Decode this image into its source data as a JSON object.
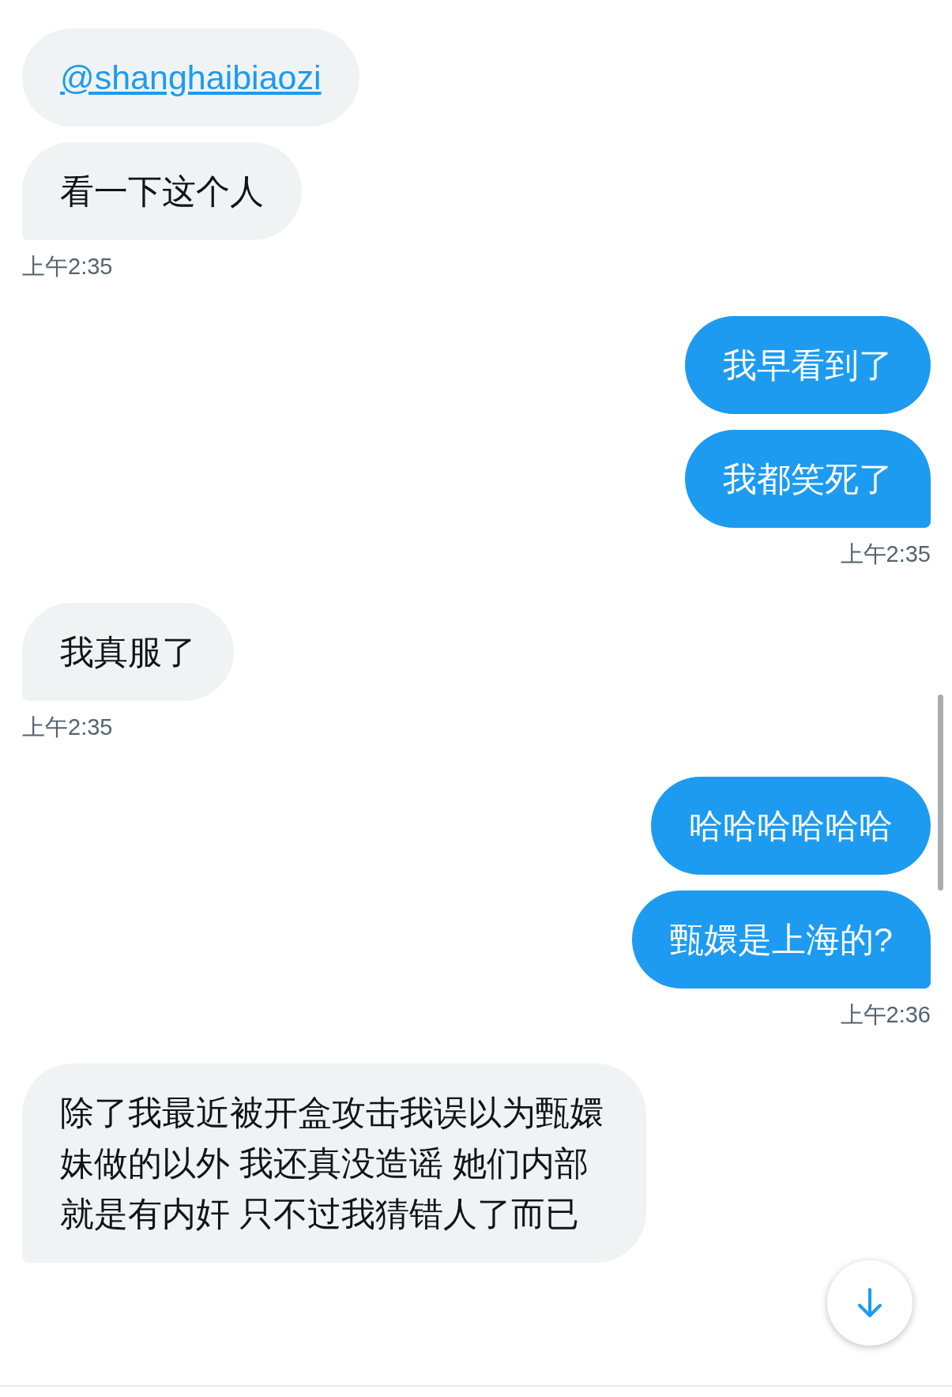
{
  "groups": [
    {
      "kind": "received",
      "messages": [
        {
          "kind": "mention",
          "text": "@shanghaibiaozi"
        },
        {
          "kind": "text",
          "text": "看一下这个人"
        }
      ],
      "time": "上午2:35"
    },
    {
      "kind": "sent",
      "messages": [
        {
          "kind": "text",
          "text": "我早看到了"
        },
        {
          "kind": "text",
          "text": "我都笑死了"
        }
      ],
      "time": "上午2:35"
    },
    {
      "kind": "received",
      "messages": [
        {
          "kind": "text",
          "text": "我真服了"
        }
      ],
      "time": "上午2:35"
    },
    {
      "kind": "sent",
      "messages": [
        {
          "kind": "text",
          "text": "哈哈哈哈哈哈"
        },
        {
          "kind": "text",
          "text": "甄嬛是上海的?"
        }
      ],
      "time": "上午2:36"
    },
    {
      "kind": "received",
      "messages": [
        {
          "kind": "text",
          "text": "除了我最近被开盒攻击我误以为甄嬛妹做的以外 我还真没造谣 她们内部就是有内奸 只不过我猜错人了而已"
        }
      ]
    }
  ]
}
